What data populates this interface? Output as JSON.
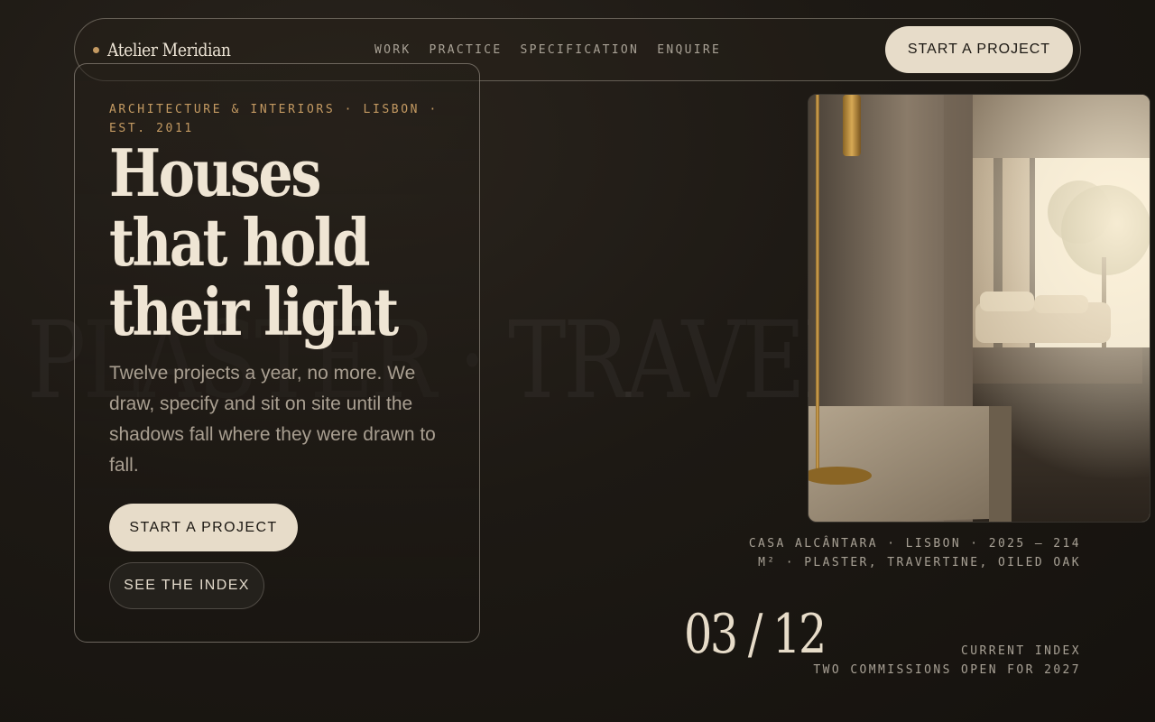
{
  "watermark": "PLASTER · TRAVERTINE",
  "nav": {
    "brand": "Atelier Meridian",
    "links": [
      "WORK",
      "PRACTICE",
      "SPECIFICATION",
      "ENQUIRE"
    ],
    "cta": "START A PROJECT"
  },
  "hero": {
    "eyebrow": "ARCHITECTURE & INTERIORS · LISBON · EST. 2011",
    "headline": "Houses that hold their light",
    "body": "Twelve projects a year, no more. We draw, specify and sit on site until the shadows fall where they were drawn to fall.",
    "primary_button": "START A PROJECT",
    "secondary_button": "SEE THE INDEX"
  },
  "feature": {
    "image_subject": "interior with plaster column, travertine block, brass floor lamp and olive tree",
    "caption": "CASA ALCÂNTARA · LISBON · 2025 — 214 M² · PLASTER, TRAVERTINE, OILED OAK"
  },
  "index": {
    "counter": "03 / 12",
    "label": "CURRENT INDEX",
    "note": "TWO COMMISSIONS OPEN FOR 2027"
  },
  "colors": {
    "accent": "#c49a62",
    "cream": "#e7dcc9",
    "background": "#1d1914"
  }
}
